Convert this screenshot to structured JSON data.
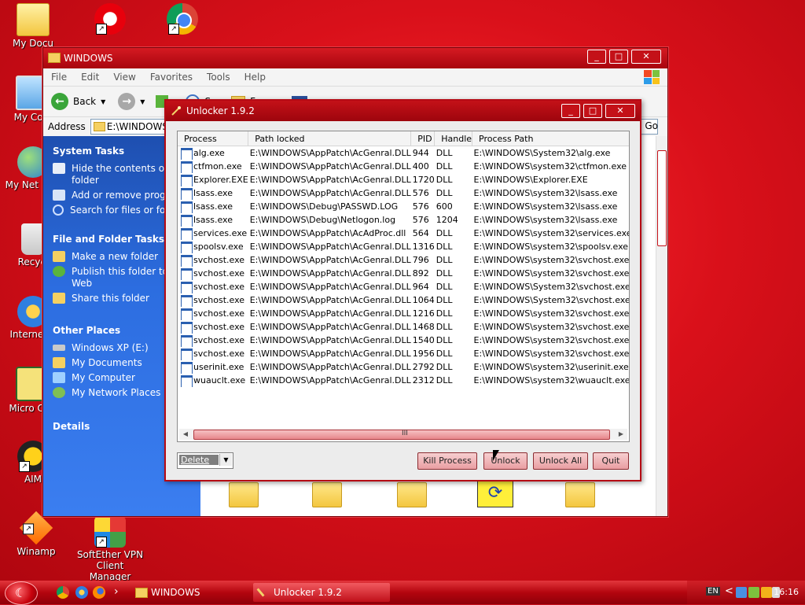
{
  "desktop": {
    "icons": [
      {
        "label": "My Docu",
        "shortcut": false
      },
      {
        "label": "",
        "shortcut": true
      },
      {
        "label": "",
        "shortcut": true
      },
      {
        "label": "My Com",
        "shortcut": false
      },
      {
        "label": "My Net Plac",
        "shortcut": false
      },
      {
        "label": "Recycl",
        "shortcut": false
      },
      {
        "label": "Internet E",
        "shortcut": false
      },
      {
        "label": "Micro Outl",
        "shortcut": false
      },
      {
        "label": "AIM",
        "shortcut": true
      },
      {
        "label": "Winamp",
        "shortcut": true
      },
      {
        "label": "SoftEther VPN Client Manager",
        "shortcut": true
      }
    ]
  },
  "explorer": {
    "title": "WINDOWS",
    "controls": {
      "minimize": "_",
      "maximize": "□",
      "close": "✕"
    },
    "menu": [
      "File",
      "Edit",
      "View",
      "Favorites",
      "Tools",
      "Help"
    ],
    "toolbar": {
      "back_label": "Back",
      "search_label": "S",
      "folders_label": "F"
    },
    "address": {
      "label": "Address",
      "value": "E:\\WINDOWS",
      "go_label": "Go"
    },
    "tasks": {
      "system_tasks_title": "System Tasks",
      "system_tasks": [
        "Hide the contents of th folder",
        "Add or remove programs",
        "Search for files or fold"
      ],
      "file_folder_title": "File and Folder Tasks",
      "file_folder_tasks": [
        "Make a new folder",
        "Publish this folder to th Web",
        "Share this folder"
      ],
      "other_places_title": "Other Places",
      "other_places": [
        "Windows XP (E:)",
        "My Documents",
        "My Computer",
        "My Network Places"
      ],
      "details_title": "Details"
    }
  },
  "unlocker": {
    "title": "Unlocker 1.9.2",
    "controls": {
      "minimize": "_",
      "maximize": "□",
      "close": "✕"
    },
    "columns": [
      "Process",
      "Path locked",
      "PID",
      "Handle",
      "Process Path"
    ],
    "rows": [
      [
        "alg.exe",
        "E:\\WINDOWS\\AppPatch\\AcGenral.DLL",
        "944",
        "DLL",
        "E:\\WINDOWS\\System32\\alg.exe"
      ],
      [
        "ctfmon.exe",
        "E:\\WINDOWS\\AppPatch\\AcGenral.DLL",
        "400",
        "DLL",
        "E:\\WINDOWS\\system32\\ctfmon.exe"
      ],
      [
        "Explorer.EXE",
        "E:\\WINDOWS\\AppPatch\\AcGenral.DLL",
        "1720",
        "DLL",
        "E:\\WINDOWS\\Explorer.EXE"
      ],
      [
        "lsass.exe",
        "E:\\WINDOWS\\AppPatch\\AcGenral.DLL",
        "576",
        "DLL",
        "E:\\WINDOWS\\system32\\lsass.exe"
      ],
      [
        "lsass.exe",
        "E:\\WINDOWS\\Debug\\PASSWD.LOG",
        "576",
        "600",
        "E:\\WINDOWS\\system32\\lsass.exe"
      ],
      [
        "lsass.exe",
        "E:\\WINDOWS\\Debug\\Netlogon.log",
        "576",
        "1204",
        "E:\\WINDOWS\\system32\\lsass.exe"
      ],
      [
        "services.exe",
        "E:\\WINDOWS\\AppPatch\\AcAdProc.dll",
        "564",
        "DLL",
        "E:\\WINDOWS\\system32\\services.exe"
      ],
      [
        "spoolsv.exe",
        "E:\\WINDOWS\\AppPatch\\AcGenral.DLL",
        "1316",
        "DLL",
        "E:\\WINDOWS\\system32\\spoolsv.exe"
      ],
      [
        "svchost.exe",
        "E:\\WINDOWS\\AppPatch\\AcGenral.DLL",
        "796",
        "DLL",
        "E:\\WINDOWS\\system32\\svchost.exe"
      ],
      [
        "svchost.exe",
        "E:\\WINDOWS\\AppPatch\\AcGenral.DLL",
        "892",
        "DLL",
        "E:\\WINDOWS\\system32\\svchost.exe"
      ],
      [
        "svchost.exe",
        "E:\\WINDOWS\\AppPatch\\AcGenral.DLL",
        "964",
        "DLL",
        "E:\\WINDOWS\\System32\\svchost.exe"
      ],
      [
        "svchost.exe",
        "E:\\WINDOWS\\AppPatch\\AcGenral.DLL",
        "1064",
        "DLL",
        "E:\\WINDOWS\\System32\\svchost.exe"
      ],
      [
        "svchost.exe",
        "E:\\WINDOWS\\AppPatch\\AcGenral.DLL",
        "1216",
        "DLL",
        "E:\\WINDOWS\\system32\\svchost.exe"
      ],
      [
        "svchost.exe",
        "E:\\WINDOWS\\AppPatch\\AcGenral.DLL",
        "1468",
        "DLL",
        "E:\\WINDOWS\\system32\\svchost.exe"
      ],
      [
        "svchost.exe",
        "E:\\WINDOWS\\AppPatch\\AcGenral.DLL",
        "1540",
        "DLL",
        "E:\\WINDOWS\\system32\\svchost.exe"
      ],
      [
        "svchost.exe",
        "E:\\WINDOWS\\AppPatch\\AcGenral.DLL",
        "1956",
        "DLL",
        "E:\\WINDOWS\\system32\\svchost.exe"
      ],
      [
        "userinit.exe",
        "E:\\WINDOWS\\AppPatch\\AcGenral.DLL",
        "2792",
        "DLL",
        "E:\\WINDOWS\\system32\\userinit.exe"
      ],
      [
        "wuauclt.exe",
        "E:\\WINDOWS\\AppPatch\\AcGenral.DLL",
        "2312",
        "DLL",
        "E:\\WINDOWS\\system32\\wuauclt.exe"
      ]
    ],
    "action_select": "Delete",
    "buttons": {
      "kill": "Kill Process",
      "unlock": "Unlock",
      "unlock_all": "Unlock All",
      "quit": "Quit"
    },
    "scroll_grip": "III"
  },
  "taskbar": {
    "items": [
      {
        "label": "WINDOWS",
        "active": false
      },
      {
        "label": "Unlocker 1.9.2",
        "active": true
      }
    ],
    "chevron": "›",
    "language": "EN",
    "tray_chevron": "<",
    "clock": "16:16"
  },
  "colors": {
    "accent": "#c41118",
    "taskpane": "#2c6de0"
  }
}
